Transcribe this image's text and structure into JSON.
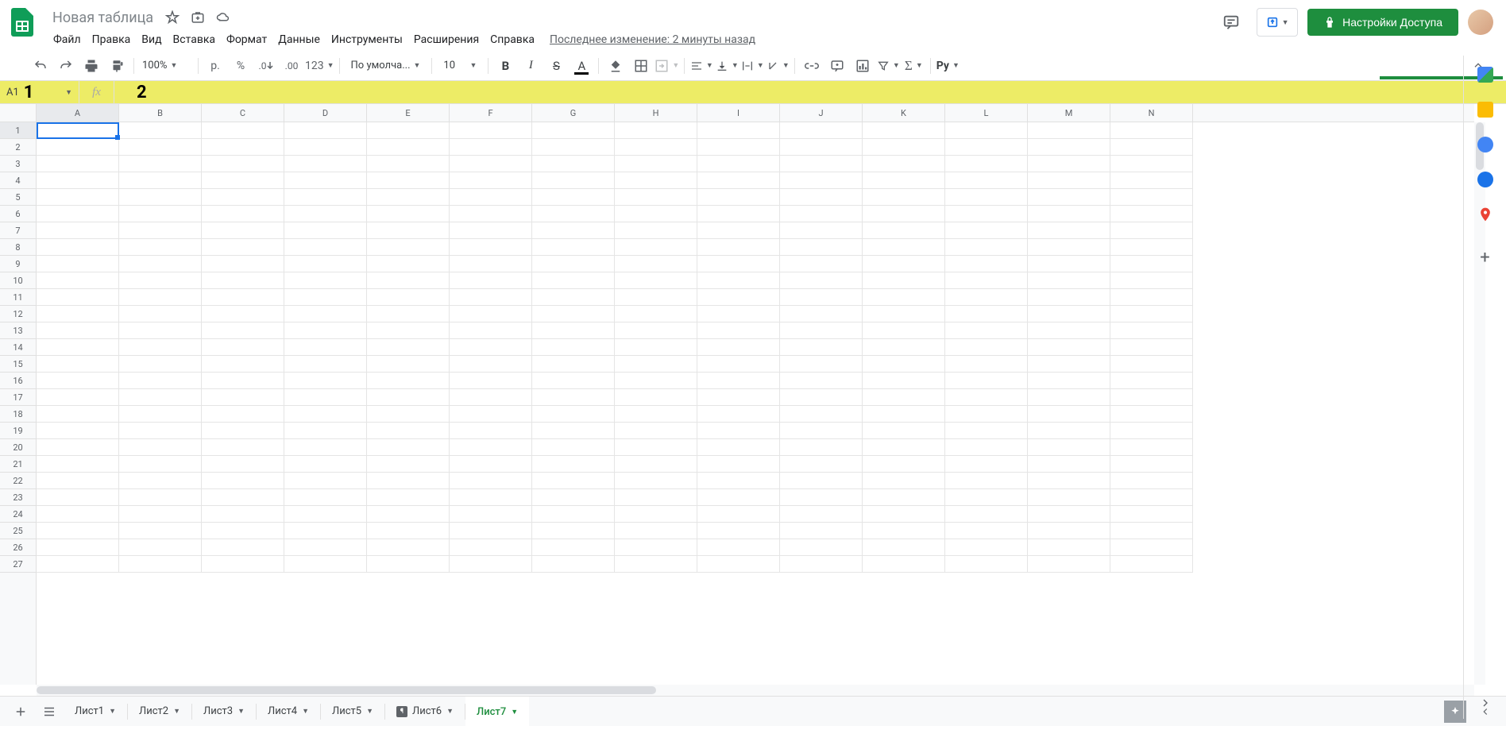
{
  "header": {
    "title": "Новая таблица",
    "last_edit": "Последнее изменение: 2 минуты назад",
    "share_label": "Настройки Доступа"
  },
  "menu": [
    "Файл",
    "Правка",
    "Вид",
    "Вставка",
    "Формат",
    "Данные",
    "Инструменты",
    "Расширения",
    "Справка"
  ],
  "toolbar": {
    "zoom": "100%",
    "currency": "р.",
    "percent": "%",
    "dec_dec": ".0",
    "inc_dec": ".00",
    "numfmt": "123",
    "font": "По умолча...",
    "fontsize": "10"
  },
  "namebox": {
    "ref": "A1",
    "annot": "1"
  },
  "formula": {
    "annot": "2"
  },
  "columns": [
    "A",
    "B",
    "C",
    "D",
    "E",
    "F",
    "G",
    "H",
    "I",
    "J",
    "K",
    "L",
    "M",
    "N"
  ],
  "rows": [
    "1",
    "2",
    "3",
    "4",
    "5",
    "6",
    "7",
    "8",
    "9",
    "10",
    "11",
    "12",
    "13",
    "14",
    "15",
    "16",
    "17",
    "18",
    "19",
    "20",
    "21",
    "22",
    "23",
    "24",
    "25",
    "26",
    "27"
  ],
  "tabs": [
    {
      "label": "Лист1",
      "guard": false
    },
    {
      "label": "Лист2",
      "guard": false
    },
    {
      "label": "Лист3",
      "guard": false
    },
    {
      "label": "Лист4",
      "guard": false
    },
    {
      "label": "Лист5",
      "guard": false
    },
    {
      "label": "Лист6",
      "guard": true
    },
    {
      "label": "Лист7",
      "guard": false
    }
  ],
  "active_tab": 6
}
